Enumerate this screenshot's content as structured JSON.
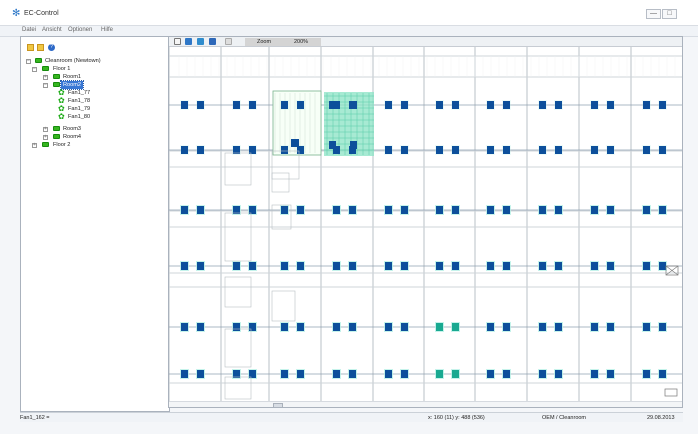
{
  "window": {
    "title": "EC-Control",
    "app_icon": "fan-icon"
  },
  "menu": {
    "items": [
      "Datei",
      "Ansicht",
      "Optionen",
      "Hilfe"
    ]
  },
  "tree": {
    "root": "Cleanroom (Newtown)",
    "floor1": "Floor 1",
    "room1": "Room1",
    "room2": "Room2",
    "fans": [
      "Fan1_77",
      "Fan1_78",
      "Fan1_79",
      "Fan1_80"
    ],
    "room3": "Room3",
    "room4": "Room4",
    "floor2": "Floor 2"
  },
  "toolbar": {
    "zoom_label": "Zoom",
    "zoom_value": "200%"
  },
  "status": {
    "left": "Fan1_162 =",
    "position": "x: 160 (11) y: 488 (536)",
    "user": "OEM / Cleanroom",
    "date": "29.08.2013"
  },
  "colors": {
    "fan_blue": "#0d4f9b",
    "fan_teal": "#19a991",
    "tree_green": "#36b51f",
    "selection": "#3977d4"
  }
}
